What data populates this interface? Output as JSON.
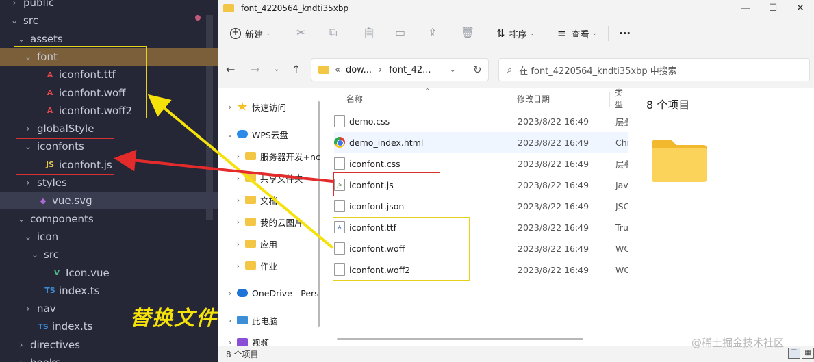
{
  "vscode": {
    "tree": [
      {
        "label": "public",
        "indent": 1,
        "chev": "›",
        "icon": "",
        "type": "folder"
      },
      {
        "label": "src",
        "indent": 1,
        "chev": "⌄",
        "icon": "",
        "type": "folder"
      },
      {
        "label": "assets",
        "indent": 2,
        "chev": "⌄",
        "icon": "",
        "type": "folder"
      },
      {
        "label": "font",
        "indent": 3,
        "chev": "⌄",
        "icon": "",
        "type": "folder",
        "selected": true
      },
      {
        "label": "iconfont.ttf",
        "indent": 4,
        "chev": "",
        "icon": "A",
        "type": "font"
      },
      {
        "label": "iconfont.woff",
        "indent": 4,
        "chev": "",
        "icon": "A",
        "type": "font"
      },
      {
        "label": "iconfont.woff2",
        "indent": 4,
        "chev": "",
        "icon": "A",
        "type": "font"
      },
      {
        "label": "globalStyle",
        "indent": 3,
        "chev": "›",
        "icon": "",
        "type": "folder"
      },
      {
        "label": "iconfonts",
        "indent": 3,
        "chev": "⌄",
        "icon": "",
        "type": "folder"
      },
      {
        "label": "iconfont.js",
        "indent": 4,
        "chev": "",
        "icon": "JS",
        "type": "js"
      },
      {
        "label": "styles",
        "indent": 3,
        "chev": "›",
        "icon": "",
        "type": "folder"
      },
      {
        "label": "vue.svg",
        "indent": 3,
        "chev": "",
        "icon": "◆",
        "type": "svg",
        "hl": true
      },
      {
        "label": "components",
        "indent": 2,
        "chev": "⌄",
        "icon": "",
        "type": "folder"
      },
      {
        "label": "icon",
        "indent": 3,
        "chev": "⌄",
        "icon": "",
        "type": "folder"
      },
      {
        "label": "src",
        "indent": 4,
        "chev": "⌄",
        "icon": "",
        "type": "folder"
      },
      {
        "label": "Icon.vue",
        "indent": 5,
        "chev": "",
        "icon": "V",
        "type": "vue"
      },
      {
        "label": "index.ts",
        "indent": 4,
        "chev": "",
        "icon": "TS",
        "type": "ts"
      },
      {
        "label": "nav",
        "indent": 3,
        "chev": "›",
        "icon": "",
        "type": "folder"
      },
      {
        "label": "index.ts",
        "indent": 3,
        "chev": "",
        "icon": "TS",
        "type": "ts"
      },
      {
        "label": "directives",
        "indent": 2,
        "chev": "›",
        "icon": "",
        "type": "folder"
      },
      {
        "label": "hooks",
        "indent": 2,
        "chev": "›",
        "icon": "",
        "type": "folder"
      }
    ],
    "overlay_text": "替换文件"
  },
  "explorer": {
    "window_title": "font_4220564_kndti35xbp",
    "toolbar": {
      "new_label": "新建",
      "sort_label": "排序",
      "view_label": "查看",
      "more_label": "···"
    },
    "address": {
      "prefix": "«",
      "part1": "dow...",
      "sep": "›",
      "part2": "font_42..."
    },
    "search_placeholder": "在 font_4220564_kndti35xbp 中搜索",
    "nav_items": [
      {
        "label": "快速访问",
        "chev": "›",
        "icon": "star"
      },
      {
        "label": "WPS云盘",
        "chev": "⌄",
        "icon": "cloud"
      },
      {
        "label": "服务器开发+nc",
        "chev": "›",
        "icon": "folder"
      },
      {
        "label": "共享文件夹",
        "chev": "›",
        "icon": "folder"
      },
      {
        "label": "文档",
        "chev": "›",
        "icon": "folder"
      },
      {
        "label": "我的云图片",
        "chev": "›",
        "icon": "folder"
      },
      {
        "label": "应用",
        "chev": "›",
        "icon": "folder"
      },
      {
        "label": "作业",
        "chev": "›",
        "icon": "folder"
      },
      {
        "label": "OneDrive - Pers",
        "chev": "›",
        "icon": "onedrive"
      },
      {
        "label": "此电脑",
        "chev": "›",
        "icon": "pc"
      },
      {
        "label": "视频",
        "chev": "›",
        "icon": "video"
      }
    ],
    "columns": {
      "name": "名称",
      "date": "修改日期",
      "type": "类型"
    },
    "files": [
      {
        "name": "demo.css",
        "date": "2023/8/22 16:49",
        "type": "层叠",
        "icon": "doc"
      },
      {
        "name": "demo_index.html",
        "date": "2023/8/22 16:49",
        "type": "Chr",
        "icon": "chrome"
      },
      {
        "name": "iconfont.css",
        "date": "2023/8/22 16:49",
        "type": "层叠",
        "icon": "doc"
      },
      {
        "name": "iconfont.js",
        "date": "2023/8/22 16:49",
        "type": "Jav",
        "icon": "js"
      },
      {
        "name": "iconfont.json",
        "date": "2023/8/22 16:49",
        "type": "JSC",
        "icon": "doc"
      },
      {
        "name": "iconfont.ttf",
        "date": "2023/8/22 16:49",
        "type": "Tru",
        "icon": "font"
      },
      {
        "name": "iconfont.woff",
        "date": "2023/8/22 16:49",
        "type": "WC",
        "icon": "doc"
      },
      {
        "name": "iconfont.woff2",
        "date": "2023/8/22 16:49",
        "type": "WC",
        "icon": "doc"
      }
    ],
    "preview_title": "8 个项目",
    "status": "8 个项目",
    "watermark": "@稀土掘金技术社区"
  },
  "colors": {
    "highlight_yellow": "#e6d21a",
    "highlight_red": "#d63131",
    "vscode_bg": "#252636",
    "selected_row": "#7a5f3a"
  }
}
